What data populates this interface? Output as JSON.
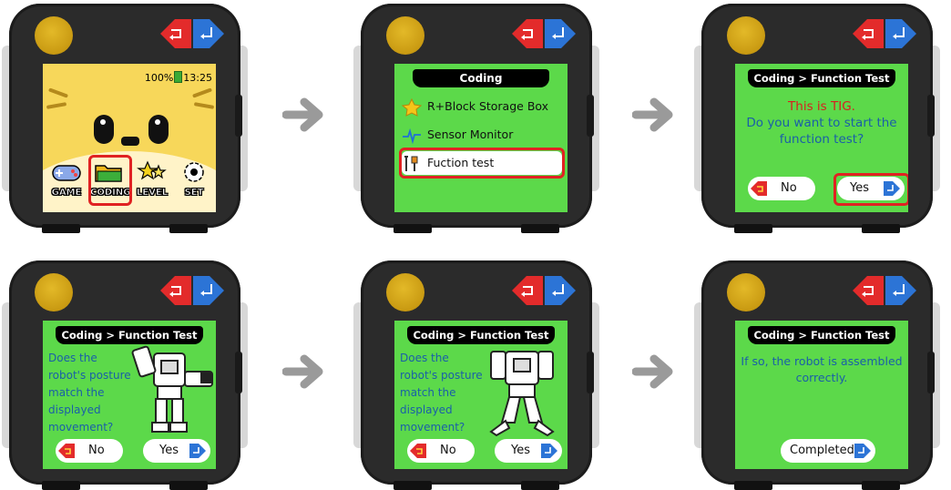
{
  "home": {
    "status": {
      "battery": "100%",
      "time": "13:25"
    },
    "apps": [
      {
        "label": "GAME",
        "icon": "gamepad-icon"
      },
      {
        "label": "CODING",
        "icon": "folder-icon"
      },
      {
        "label": "LEVEL",
        "icon": "stars-icon"
      },
      {
        "label": "SET",
        "icon": "gear-icon"
      }
    ],
    "selected_app": "CODING"
  },
  "coding_menu": {
    "title": "Coding",
    "items": [
      {
        "label": "R+Block Storage Box",
        "icon": "star-icon"
      },
      {
        "label": "Sensor Monitor",
        "icon": "pulse-icon"
      },
      {
        "label": "Fuction test",
        "icon": "tools-icon"
      }
    ],
    "selected_item": "Fuction test"
  },
  "confirm": {
    "title": "Coding > Function Test",
    "line_red": "This is TIG.",
    "line_blue": "Do you want to start the function test?",
    "no_label": "No",
    "yes_label": "Yes"
  },
  "check1": {
    "title": "Coding > Function Test",
    "question": "Does the robot's posture match the displayed movement?",
    "no_label": "No",
    "yes_label": "Yes"
  },
  "check2": {
    "title": "Coding > Function Test",
    "question": "Does the robot's posture match the displayed movement?",
    "no_label": "No",
    "yes_label": "Yes"
  },
  "done": {
    "title": "Coding > Function Test",
    "message": "If so, the robot is assembled correctly.",
    "completed_label": "Completed"
  },
  "colors": {
    "screen_green": "#5cd94a",
    "screen_yellow": "#f7d75a",
    "highlight_red": "#e02222",
    "text_blue": "#1a5fa8",
    "text_red": "#d81f1f"
  }
}
